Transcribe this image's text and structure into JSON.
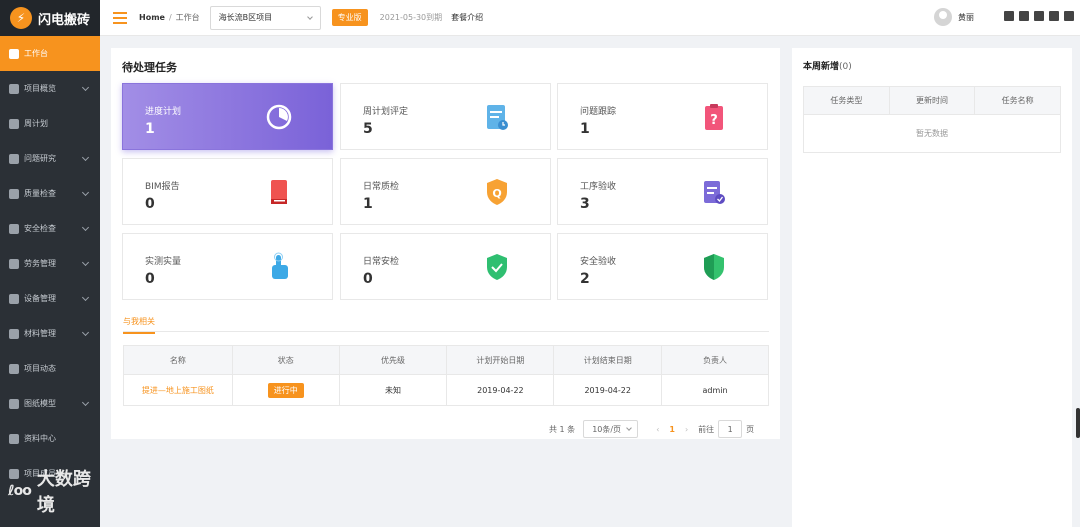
{
  "sidebar": {
    "logo": "闪电搬砖",
    "items": [
      {
        "label": "工作台"
      },
      {
        "label": "项目概览"
      },
      {
        "label": "周计划"
      },
      {
        "label": "问题研究"
      },
      {
        "label": "质量检查"
      },
      {
        "label": "安全检查"
      },
      {
        "label": "劳务管理"
      },
      {
        "label": "设备管理"
      },
      {
        "label": "材料管理"
      },
      {
        "label": "项目动态"
      },
      {
        "label": "图纸模型"
      },
      {
        "label": "资料中心"
      },
      {
        "label": "项目成员"
      }
    ],
    "watermark": "大数跨境"
  },
  "header": {
    "breadcrumb_home": "Home",
    "breadcrumb_sep": "/",
    "breadcrumb_current": "工作台",
    "project_select": "海长流B区项目",
    "edition_tag": "专业版",
    "expire": "2021-05-30到期",
    "package": "套餐介绍",
    "username": "黄丽"
  },
  "main": {
    "title": "待处理任务",
    "cards": [
      {
        "label": "进度计划",
        "value": "1"
      },
      {
        "label": "周计划评定",
        "value": "5"
      },
      {
        "label": "问题跟踪",
        "value": "1"
      },
      {
        "label": "BIM报告",
        "value": "0"
      },
      {
        "label": "日常质检",
        "value": "1"
      },
      {
        "label": "工序验收",
        "value": "3"
      },
      {
        "label": "实测实量",
        "value": "0"
      },
      {
        "label": "日常安检",
        "value": "0"
      },
      {
        "label": "安全验收",
        "value": "2"
      }
    ],
    "tab": "与我相关",
    "table": {
      "headers": [
        "名称",
        "状态",
        "优先级",
        "计划开始日期",
        "计划结束日期",
        "负责人"
      ],
      "rows": [
        {
          "name": "提进—地上施工图纸",
          "status": "进行中",
          "priority": "未知",
          "start": "2019-04-22",
          "end": "2019-04-22",
          "owner": "admin"
        }
      ]
    },
    "pager": {
      "total": "共 1 条",
      "size": "10条/页",
      "prev": "‹",
      "page": "1",
      "next": "›",
      "goto": "前往",
      "goto_value": "1",
      "page_unit": "页"
    }
  },
  "right": {
    "title": "本周新增",
    "count": "(0)",
    "headers": [
      "任务类型",
      "更新时间",
      "任务名称"
    ],
    "empty": "暂无数据"
  }
}
